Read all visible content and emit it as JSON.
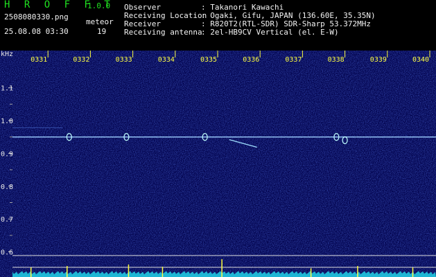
{
  "header": {
    "app_name": "HROFFT",
    "version": "1.0.0",
    "file_name": "2508080330.png",
    "timestamp": "25.08.08 03:30",
    "meteor_label": "meteor",
    "meteor_count": "19"
  },
  "meta": [
    {
      "label": "Observer",
      "value": ": Takanori Kawachi"
    },
    {
      "label": "Receiving Location",
      "value": ": Ogaki, Gifu, JAPAN (136.60E, 35.35N)"
    },
    {
      "label": "Receiver",
      "value": ": R820T2(RTL-SDR) SDR-Sharp 53.372MHz"
    },
    {
      "label": "Receiving antenna",
      "value": ": 2el-HB9CV Vertical (el. E-W)"
    }
  ],
  "colors": {
    "background": "#00004a",
    "signal": "#e0ffff",
    "x_tick_label": "#ffff40",
    "header_accent": "#20e020"
  },
  "chart_data": {
    "type": "heatmap",
    "y_unit_label": "kHz",
    "y_ticks": [
      "1.1",
      "1.0",
      "0.9",
      "0.8",
      "0.7",
      "0.6"
    ],
    "y_tick_values": [
      1.1,
      1.0,
      0.9,
      0.8,
      0.7,
      0.6
    ],
    "x_ticks": [
      "0331",
      "0332",
      "0333",
      "0334",
      "0335",
      "0336",
      "0337",
      "0338",
      "0339",
      "0340"
    ],
    "x_range_minutes": [
      0,
      10
    ],
    "ylim": [
      0.58,
      1.205
    ],
    "carrier_khz": 0.95,
    "echoes": [
      {
        "t": 1.5,
        "f": 0.95
      },
      {
        "t": 2.85,
        "f": 0.95
      },
      {
        "t": 4.7,
        "f": 0.95
      },
      {
        "t": 5.6,
        "f": 0.925
      },
      {
        "t": 7.8,
        "f": 0.95
      },
      {
        "t": 8.0,
        "f": 0.94
      }
    ],
    "spectrum_peaks": [
      {
        "t": 0.6,
        "level": 0.35
      },
      {
        "t": 1.45,
        "level": 0.45
      },
      {
        "t": 2.9,
        "level": 0.55
      },
      {
        "t": 3.7,
        "level": 0.4
      },
      {
        "t": 5.1,
        "level": 0.9
      },
      {
        "t": 7.2,
        "level": 0.3
      },
      {
        "t": 8.3,
        "level": 0.45
      },
      {
        "t": 9.6,
        "level": 0.35
      }
    ]
  }
}
